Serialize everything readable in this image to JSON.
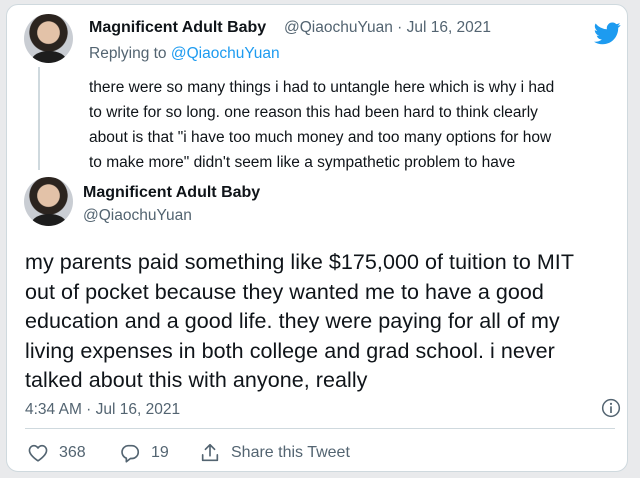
{
  "reply_tweet": {
    "author_name": "Magnificent Adult Baby",
    "handle_date": "@QiaochuYuan · Jul 16, 2021",
    "replying_prefix": "Replying to",
    "replying_handle": "@QiaochuYuan",
    "text": "there were so many things i had to untangle here which is why i had\nto write for so long. one reason this had been hard to think clearly\nabout is that \"i have too much money and too many options for how\nto make more\" didn't seem like a sympathetic problem to have"
  },
  "main_tweet": {
    "author_name": "Magnificent Adult Baby",
    "handle": "@QiaochuYuan",
    "text": "my parents paid something like $175,000 of tuition to MIT\nout of pocket because they wanted me to have a good\neducation and a good life. they were paying for all of my\nliving expenses in both college and grad school. i never\ntalked about this with anyone, really",
    "timestamp": "4:34 AM · Jul 16, 2021"
  },
  "actions": {
    "likes": "368",
    "replies": "19",
    "share_label": "Share this Tweet"
  },
  "icons": {
    "brand": "twitter-bird-icon",
    "info": "info-icon",
    "like": "heart-icon",
    "reply": "reply-bubble-icon",
    "share": "share-icon"
  },
  "colors": {
    "brand_blue": "#1d9bf0",
    "muted_text": "#536471",
    "border": "#cfd9de"
  }
}
